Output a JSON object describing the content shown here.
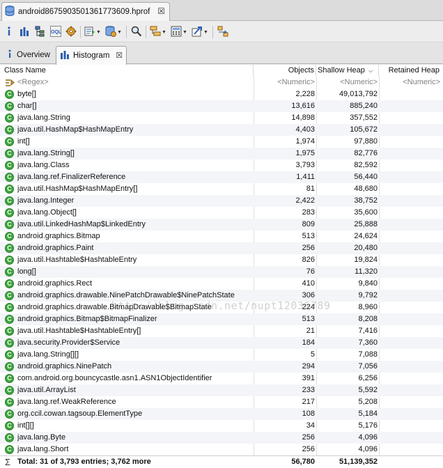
{
  "editor_tab": {
    "title": "android8675903501361773609.hprof",
    "close": "☒"
  },
  "view_tabs": {
    "overview": "Overview",
    "histogram": "Histogram",
    "close": "☒"
  },
  "columns": {
    "class_name": "Class Name",
    "objects": "Objects",
    "shallow_heap": "Shallow Heap",
    "retained_heap": "Retained Heap"
  },
  "filter_row": {
    "regex": "<Regex>",
    "objects": "<Numeric>",
    "shallow": "<Numeric>",
    "retained": "<Numeric>"
  },
  "rows": [
    {
      "name": "byte[]",
      "objects": "2,228",
      "shallow": "49,013,792",
      "retained": ""
    },
    {
      "name": "char[]",
      "objects": "13,616",
      "shallow": "885,240",
      "retained": ""
    },
    {
      "name": "java.lang.String",
      "objects": "14,898",
      "shallow": "357,552",
      "retained": ""
    },
    {
      "name": "java.util.HashMap$HashMapEntry",
      "objects": "4,403",
      "shallow": "105,672",
      "retained": ""
    },
    {
      "name": "int[]",
      "objects": "1,974",
      "shallow": "97,880",
      "retained": ""
    },
    {
      "name": "java.lang.String[]",
      "objects": "1,975",
      "shallow": "82,776",
      "retained": ""
    },
    {
      "name": "java.lang.Class",
      "objects": "3,793",
      "shallow": "82,592",
      "retained": ""
    },
    {
      "name": "java.lang.ref.FinalizerReference",
      "objects": "1,411",
      "shallow": "56,440",
      "retained": ""
    },
    {
      "name": "java.util.HashMap$HashMapEntry[]",
      "objects": "81",
      "shallow": "48,680",
      "retained": ""
    },
    {
      "name": "java.lang.Integer",
      "objects": "2,422",
      "shallow": "38,752",
      "retained": ""
    },
    {
      "name": "java.lang.Object[]",
      "objects": "283",
      "shallow": "35,600",
      "retained": ""
    },
    {
      "name": "java.util.LinkedHashMap$LinkedEntry",
      "objects": "809",
      "shallow": "25,888",
      "retained": ""
    },
    {
      "name": "android.graphics.Bitmap",
      "objects": "513",
      "shallow": "24,624",
      "retained": ""
    },
    {
      "name": "android.graphics.Paint",
      "objects": "256",
      "shallow": "20,480",
      "retained": ""
    },
    {
      "name": "java.util.Hashtable$HashtableEntry",
      "objects": "826",
      "shallow": "19,824",
      "retained": ""
    },
    {
      "name": "long[]",
      "objects": "76",
      "shallow": "11,320",
      "retained": ""
    },
    {
      "name": "android.graphics.Rect",
      "objects": "410",
      "shallow": "9,840",
      "retained": ""
    },
    {
      "name": "android.graphics.drawable.NinePatchDrawable$NinePatchState",
      "objects": "306",
      "shallow": "9,792",
      "retained": ""
    },
    {
      "name": "android.graphics.drawable.BitmapDrawable$BitmapState",
      "objects": "224",
      "shallow": "8,960",
      "retained": ""
    },
    {
      "name": "android.graphics.Bitmap$BitmapFinalizer",
      "objects": "513",
      "shallow": "8,208",
      "retained": ""
    },
    {
      "name": "java.util.Hashtable$HashtableEntry[]",
      "objects": "21",
      "shallow": "7,416",
      "retained": ""
    },
    {
      "name": "java.security.Provider$Service",
      "objects": "184",
      "shallow": "7,360",
      "retained": ""
    },
    {
      "name": "java.lang.String[][]",
      "objects": "5",
      "shallow": "7,088",
      "retained": ""
    },
    {
      "name": "android.graphics.NinePatch",
      "objects": "294",
      "shallow": "7,056",
      "retained": ""
    },
    {
      "name": "com.android.org.bouncycastle.asn1.ASN1ObjectIdentifier",
      "objects": "391",
      "shallow": "6,256",
      "retained": ""
    },
    {
      "name": "java.util.ArrayList",
      "objects": "233",
      "shallow": "5,592",
      "retained": ""
    },
    {
      "name": "java.lang.ref.WeakReference",
      "objects": "217",
      "shallow": "5,208",
      "retained": ""
    },
    {
      "name": "org.ccil.cowan.tagsoup.ElementType",
      "objects": "108",
      "shallow": "5,184",
      "retained": ""
    },
    {
      "name": "int[][]",
      "objects": "34",
      "shallow": "5,176",
      "retained": ""
    },
    {
      "name": "java.lang.Byte",
      "objects": "256",
      "shallow": "4,096",
      "retained": ""
    },
    {
      "name": "java.lang.Short",
      "objects": "256",
      "shallow": "4,096",
      "retained": ""
    }
  ],
  "total": {
    "label": "Total: 31 of 3,793 entries; 3,762 more",
    "objects": "56,780",
    "shallow": "51,139,352",
    "retained": ""
  },
  "watermark": "http://blog.csdn.net/nupt12036789"
}
